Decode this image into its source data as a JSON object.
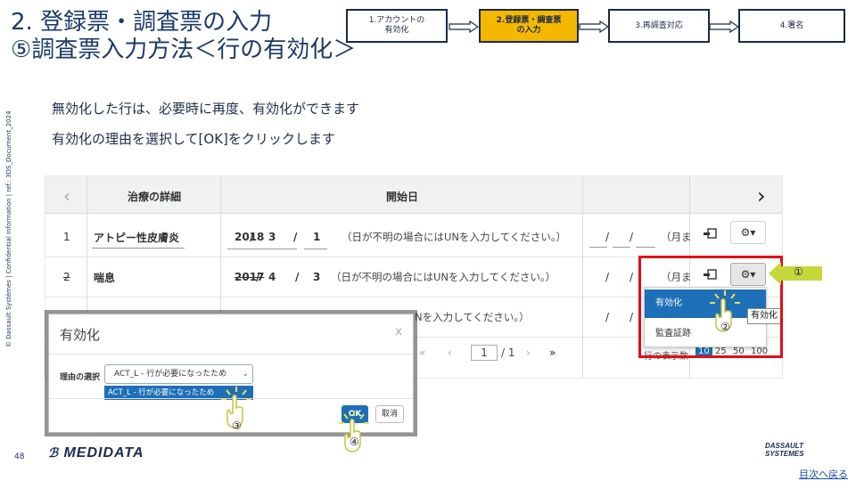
{
  "header": {
    "title_line1": "2. 登録票・調査票の入力",
    "title_line2": "⑤調査票入力方法＜行の有効化＞",
    "steps": [
      {
        "label": "1.アカウントの\n有効化",
        "active": false
      },
      {
        "label": "2.登録票・調査票\nの入力",
        "active": true
      },
      {
        "label": "3.再調査対応",
        "active": false
      },
      {
        "label": "4.署名",
        "active": false
      }
    ]
  },
  "instructions": {
    "line1": "無効化した行は、必要時に再度、有効化ができます",
    "line2": "有効化の理由を選択して[OK]をクリックします"
  },
  "side_note": "© Dassault Systèmes | Confidential Information | ref.: 3DS_Document_2024",
  "table": {
    "col_treatment": "治療の詳細",
    "col_start": "開始日",
    "nav_prev": "‹",
    "nav_next": "›",
    "rows": [
      {
        "no": "1",
        "treatment": "アトピー性皮膚炎",
        "year": "2018",
        "month": "3",
        "day": "1",
        "hint": "（日が不明の場合にはUNを入力してください。）",
        "end_hint": "（月ま"
      },
      {
        "no": "2",
        "treatment": "喘息",
        "year": "2017",
        "month": "4",
        "day": "3",
        "hint": "（日が不明の場合にはUNを入力してください。）",
        "end_hint": "（月ま"
      },
      {
        "no": "3",
        "hint": "Nを入力してください。）"
      }
    ],
    "date_sep": "/",
    "gear_label": "⚙▾"
  },
  "row_menu": {
    "items": [
      "有効化",
      "監査証跡"
    ],
    "tooltip": "有効化"
  },
  "pager": {
    "page": "1",
    "total": "/ 1",
    "per_page_label": "行の表示数",
    "sizes": [
      "10",
      "25",
      "50",
      "100"
    ],
    "selected_size": "10"
  },
  "modal": {
    "title": "有効化",
    "close": "x",
    "reason_label": "理由の選択",
    "selected_reason": "ACT_L - 行が必要になったため",
    "option": "ACT_L - 行が必要になったため",
    "ok": "OK",
    "cancel": "取消"
  },
  "callouts": {
    "c1": "①",
    "c2": "②",
    "c3": "③",
    "c4": "④"
  },
  "footer": {
    "page_number": "48",
    "medidata": "MEDIDATA",
    "ds_line1": "DASSAULT",
    "ds_line2": "SYSTEMES",
    "toc": "目次へ戻る"
  },
  "colors": {
    "accent_blue": "#1d6fb8",
    "highlight_red": "#e30d17",
    "step_active": "#f5b800",
    "callout_green": "#c5d93a"
  }
}
